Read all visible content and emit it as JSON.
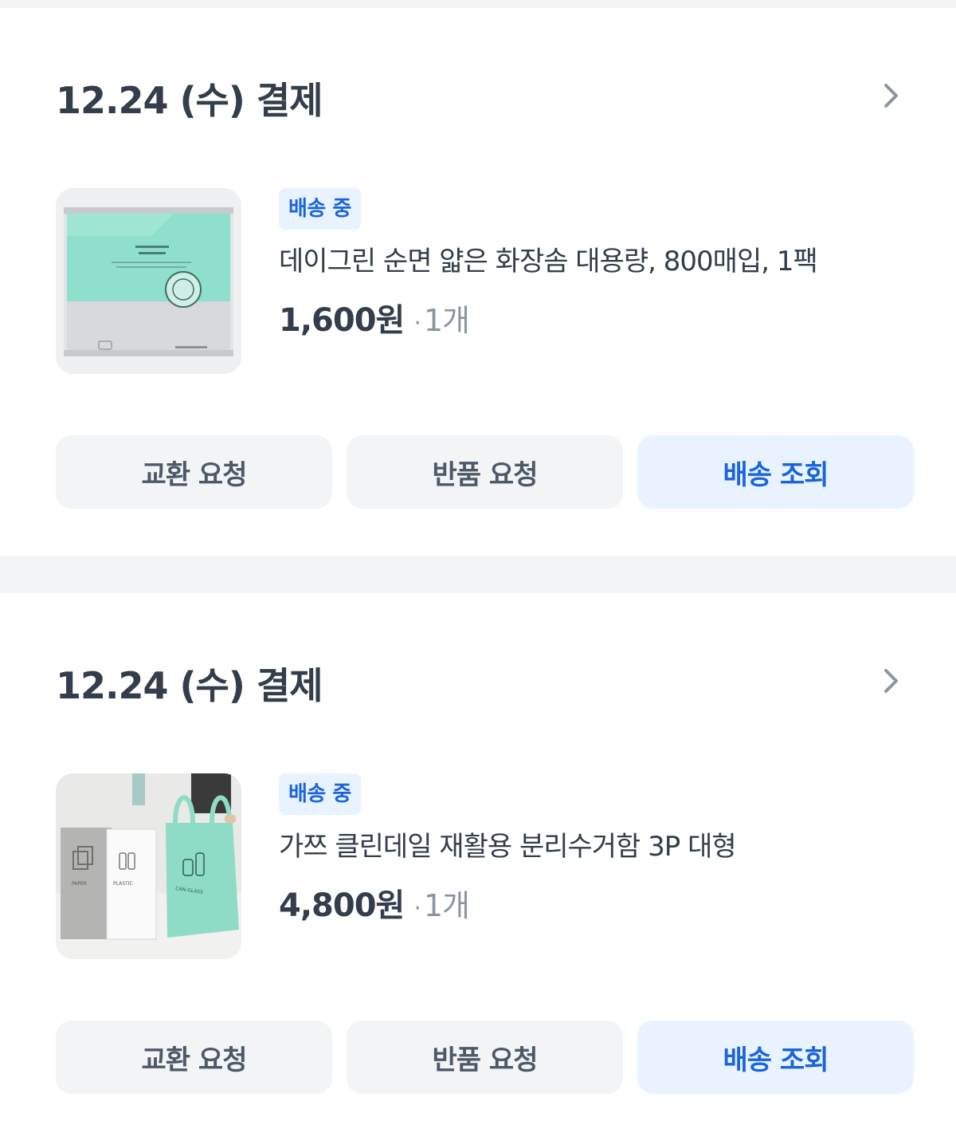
{
  "orders": [
    {
      "date_label": "12.24 (수) 결제",
      "status_badge": "배송 중",
      "product_name": "데이그린 순면 얇은 화장솜 대용량, 800매입, 1팩",
      "price": "1,600원",
      "quantity": "1개",
      "image_icon": "cotton-pad-package-image",
      "buttons": {
        "exchange": "교환 요청",
        "return": "반품 요청",
        "track": "배송 조회"
      }
    },
    {
      "date_label": "12.24 (수) 결제",
      "status_badge": "배송 중",
      "product_name": "가쯔 클린데일 재활용 분리수거함 3P 대형",
      "price": "4,800원",
      "quantity": "1개",
      "image_icon": "recycling-bin-bags-image",
      "image_text": [
        "PAPER",
        "PLASTIC",
        "CAN-GLASS"
      ],
      "buttons": {
        "exchange": "교환 요청",
        "return": "반품 요청",
        "track": "배송 조회"
      }
    }
  ],
  "colors": {
    "background": "#f2f4f6",
    "card": "#ffffff",
    "primary_text": "#333d4b",
    "muted_text": "#8b95a1",
    "accent": "#1b64da",
    "accent_bg": "#e8f3ff",
    "button_gray_bg": "#f2f4f6"
  }
}
